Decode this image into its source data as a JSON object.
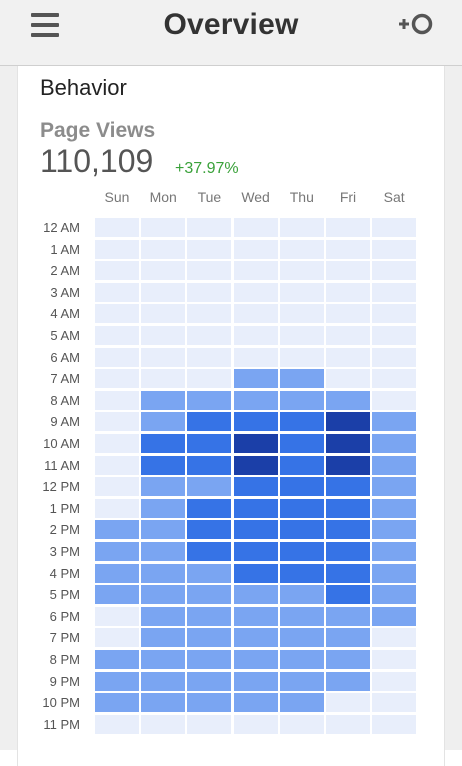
{
  "header": {
    "title": "Overview",
    "menu_icon": "hamburger-menu-icon",
    "add_icon": "add-segment-icon"
  },
  "section": {
    "title": "Behavior"
  },
  "metric": {
    "label": "Page Views",
    "value": "110,109",
    "change": "+37.97%"
  },
  "colors": {
    "level0": "#e8eefb",
    "level1": "#7aa5f2",
    "level2": "#3673e6",
    "level3": "#1b3fa8",
    "change": "#3aa13a"
  },
  "chart_data": {
    "type": "heatmap",
    "days": [
      "Sun",
      "Mon",
      "Tue",
      "Wed",
      "Thu",
      "Fri",
      "Sat"
    ],
    "hours": [
      "12 AM",
      "1 AM",
      "2 AM",
      "3 AM",
      "4 AM",
      "5 AM",
      "6 AM",
      "7 AM",
      "8 AM",
      "9 AM",
      "10 AM",
      "11 AM",
      "12 PM",
      "1 PM",
      "2 PM",
      "3 PM",
      "4 PM",
      "5 PM",
      "6 PM",
      "7 PM",
      "8 PM",
      "9 PM",
      "10 PM",
      "11 PM"
    ],
    "levels": [
      [
        0,
        0,
        0,
        0,
        0,
        0,
        0
      ],
      [
        0,
        0,
        0,
        0,
        0,
        0,
        0
      ],
      [
        0,
        0,
        0,
        0,
        0,
        0,
        0
      ],
      [
        0,
        0,
        0,
        0,
        0,
        0,
        0
      ],
      [
        0,
        0,
        0,
        0,
        0,
        0,
        0
      ],
      [
        0,
        0,
        0,
        0,
        0,
        0,
        0
      ],
      [
        0,
        0,
        0,
        0,
        0,
        0,
        0
      ],
      [
        0,
        0,
        0,
        1,
        1,
        0,
        0
      ],
      [
        0,
        1,
        1,
        1,
        1,
        1,
        0
      ],
      [
        0,
        1,
        2,
        2,
        2,
        3,
        1
      ],
      [
        0,
        2,
        2,
        3,
        2,
        3,
        1
      ],
      [
        0,
        2,
        2,
        3,
        2,
        3,
        1
      ],
      [
        0,
        1,
        1,
        2,
        2,
        2,
        1
      ],
      [
        0,
        1,
        2,
        2,
        2,
        2,
        1
      ],
      [
        1,
        1,
        2,
        2,
        2,
        2,
        1
      ],
      [
        1,
        1,
        2,
        2,
        2,
        2,
        1
      ],
      [
        1,
        1,
        1,
        2,
        2,
        2,
        1
      ],
      [
        1,
        1,
        1,
        1,
        1,
        2,
        1
      ],
      [
        0,
        1,
        1,
        1,
        1,
        1,
        1
      ],
      [
        0,
        1,
        1,
        1,
        1,
        1,
        0
      ],
      [
        1,
        1,
        1,
        1,
        1,
        1,
        0
      ],
      [
        1,
        1,
        1,
        1,
        1,
        1,
        0
      ],
      [
        1,
        1,
        1,
        1,
        1,
        0,
        0
      ],
      [
        0,
        0,
        0,
        0,
        0,
        0,
        0
      ]
    ],
    "scale": {
      "min_level": 0,
      "max_level": 3
    }
  }
}
